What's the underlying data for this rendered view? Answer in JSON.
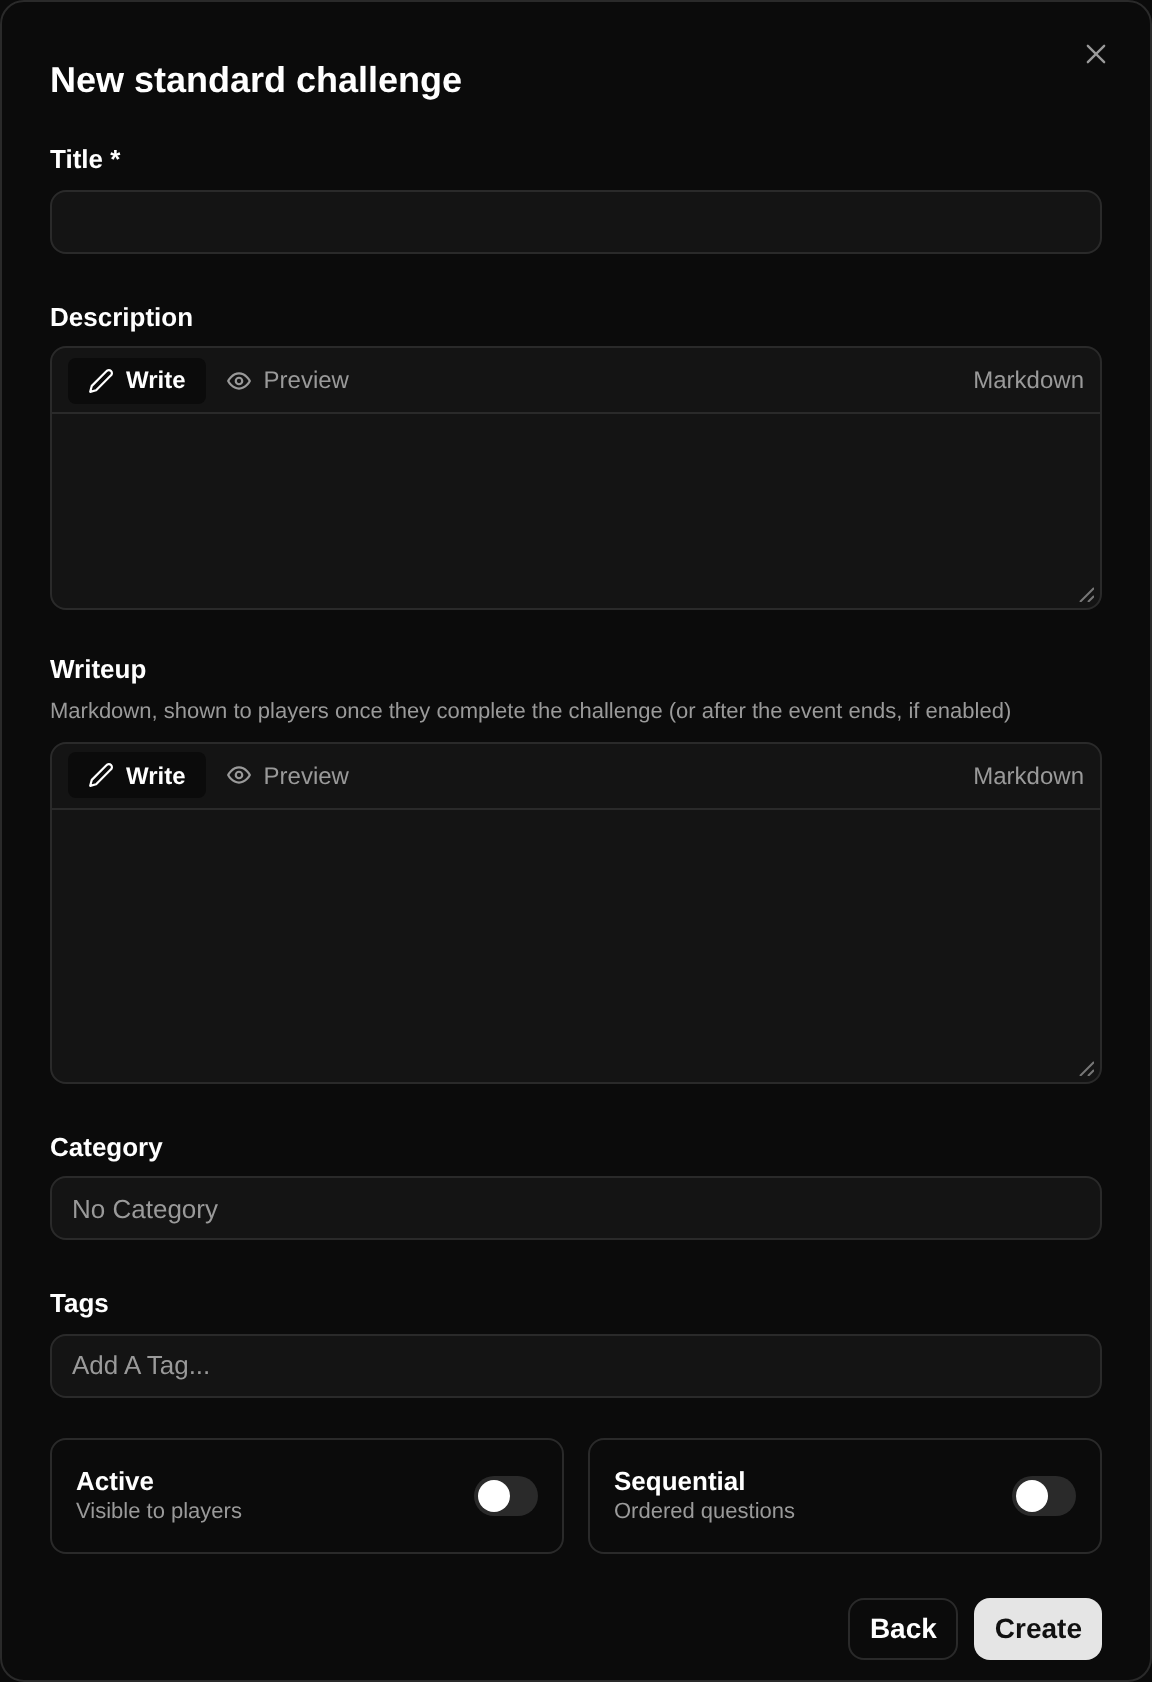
{
  "dialog": {
    "title": "New standard challenge"
  },
  "title_field": {
    "label": "Title *"
  },
  "description": {
    "label": "Description",
    "tabs": [
      {
        "label": "Write",
        "selected": true
      },
      {
        "label": "Preview",
        "selected": false
      }
    ],
    "format": "Markdown"
  },
  "writeup": {
    "label": "Writeup",
    "hint": "Markdown, shown to players once they complete the challenge (or after the event ends, if enabled)",
    "tabs": [
      {
        "label": "Write",
        "selected": true
      },
      {
        "label": "Preview",
        "selected": false
      }
    ],
    "format": "Markdown"
  },
  "category": {
    "label": "Category",
    "placeholder": "No Category"
  },
  "tags": {
    "label": "Tags",
    "placeholder": "Add A Tag..."
  },
  "toggles": [
    {
      "label": "Active",
      "description": "Visible to players",
      "on": false
    },
    {
      "label": "Sequential",
      "description": "Ordered questions",
      "on": false
    }
  ],
  "buttons": [
    {
      "label": "Back",
      "kind": "secondary"
    },
    {
      "label": "Create",
      "kind": "primary"
    }
  ]
}
